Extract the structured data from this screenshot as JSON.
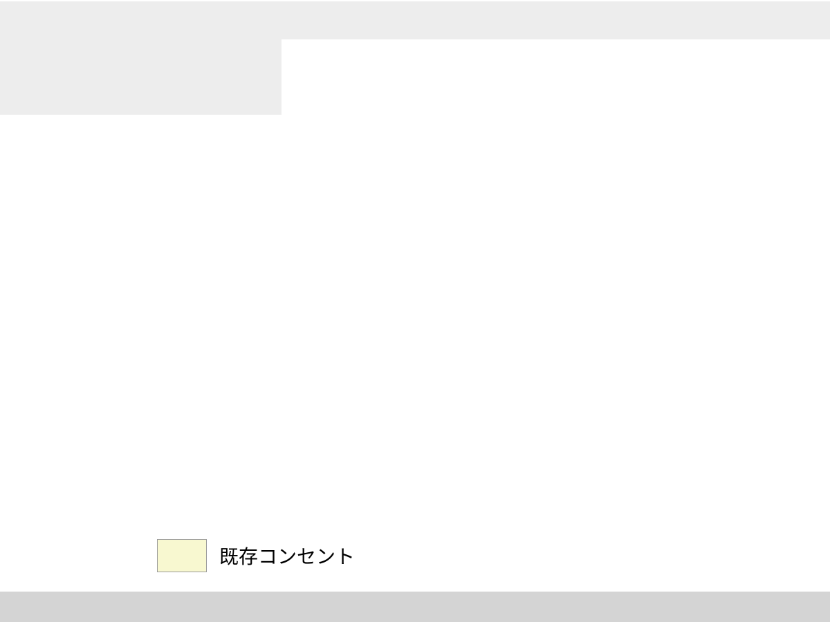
{
  "legend": {
    "items": [
      {
        "label": "既存コンセント",
        "swatch_color": "#f8f8d0",
        "border_color": "#999999"
      }
    ]
  }
}
